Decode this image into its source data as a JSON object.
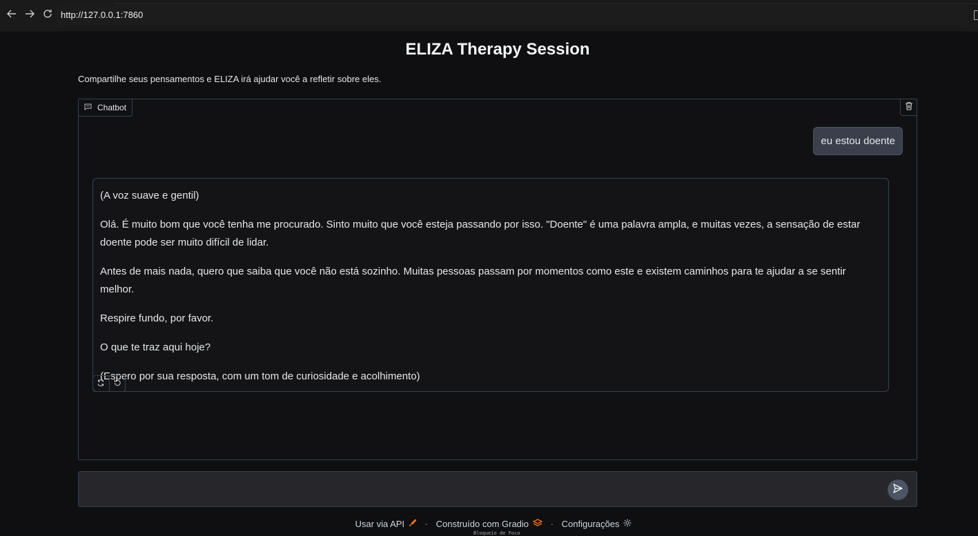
{
  "browser": {
    "url": "http://127.0.0.1:7860"
  },
  "page": {
    "title": "ELIZA Therapy Session",
    "subtitle": "Compartilhe seus pensamentos e ELIZA irá ajudar você a refletir sobre eles."
  },
  "chatbot": {
    "label": "Chatbot",
    "messages": {
      "user": "eu estou doente",
      "bot": [
        "(A voz suave e gentil)",
        "Olá. É muito bom que você tenha me procurado. Sinto muito que você esteja passando por isso. \"Doente\" é uma palavra ampla, e muitas vezes, a sensação de estar doente pode ser muito difícil de lidar.",
        "Antes de mais nada, quero que saiba que você não está sozinho. Muitas pessoas passam por momentos como este e existem caminhos para te ajudar a se sentir melhor.",
        "Respire fundo, por favor.",
        "O que te traz aqui hoje?",
        "(Espero por sua resposta, com um tom de curiosidade e acolhimento)"
      ]
    }
  },
  "input": {
    "value": "",
    "placeholder": ""
  },
  "footer": {
    "api_link": "Usar via API",
    "gradio_link": "Construído com Gradio",
    "settings_link": "Configurações",
    "separator": "·",
    "tooltip": "Bloqueio de Foco"
  },
  "icons": {
    "back": "arrow-left-icon",
    "forward": "arrow-right-icon",
    "reload": "reload-icon",
    "chat": "chat-bubble-icon",
    "trash": "trash-icon",
    "retry": "retry-icon",
    "undo": "undo-icon",
    "send": "send-icon",
    "rocket": "rocket-icon",
    "gradio": "gradio-logo-icon",
    "gear": "gear-icon"
  }
}
